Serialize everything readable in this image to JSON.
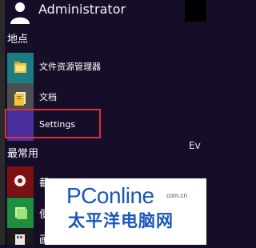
{
  "header": {
    "user_name": "Administrator"
  },
  "sections": {
    "places_title": "地点",
    "frequent_title": "最常用"
  },
  "places": [
    {
      "label": "文件资源管理器",
      "icon": "folder-icon",
      "tile_color": "#1b7c84"
    },
    {
      "label": "文档",
      "icon": "documents-icon",
      "tile_color": "#4e4e4e"
    },
    {
      "label": "Settings",
      "icon": "settings-icon",
      "tile_color": "#4a2f9e"
    }
  ],
  "frequent": [
    {
      "label": "截",
      "icon": "app-icon",
      "tile_color": "#7d1010"
    },
    {
      "label": "便",
      "icon": "sticky-notes-icon",
      "tile_color": "#1e8f3e"
    },
    {
      "label": "画",
      "icon": "paint-icon",
      "tile_color": "#1a1a1a"
    }
  ],
  "side_text": "Ev",
  "watermark": {
    "brand": "PConline",
    "domain": ".com.cn",
    "chinese": "太平洋电脑网"
  },
  "colors": {
    "background": "#160e28",
    "highlight": "#d8323c",
    "brand": "#1a56b8"
  }
}
